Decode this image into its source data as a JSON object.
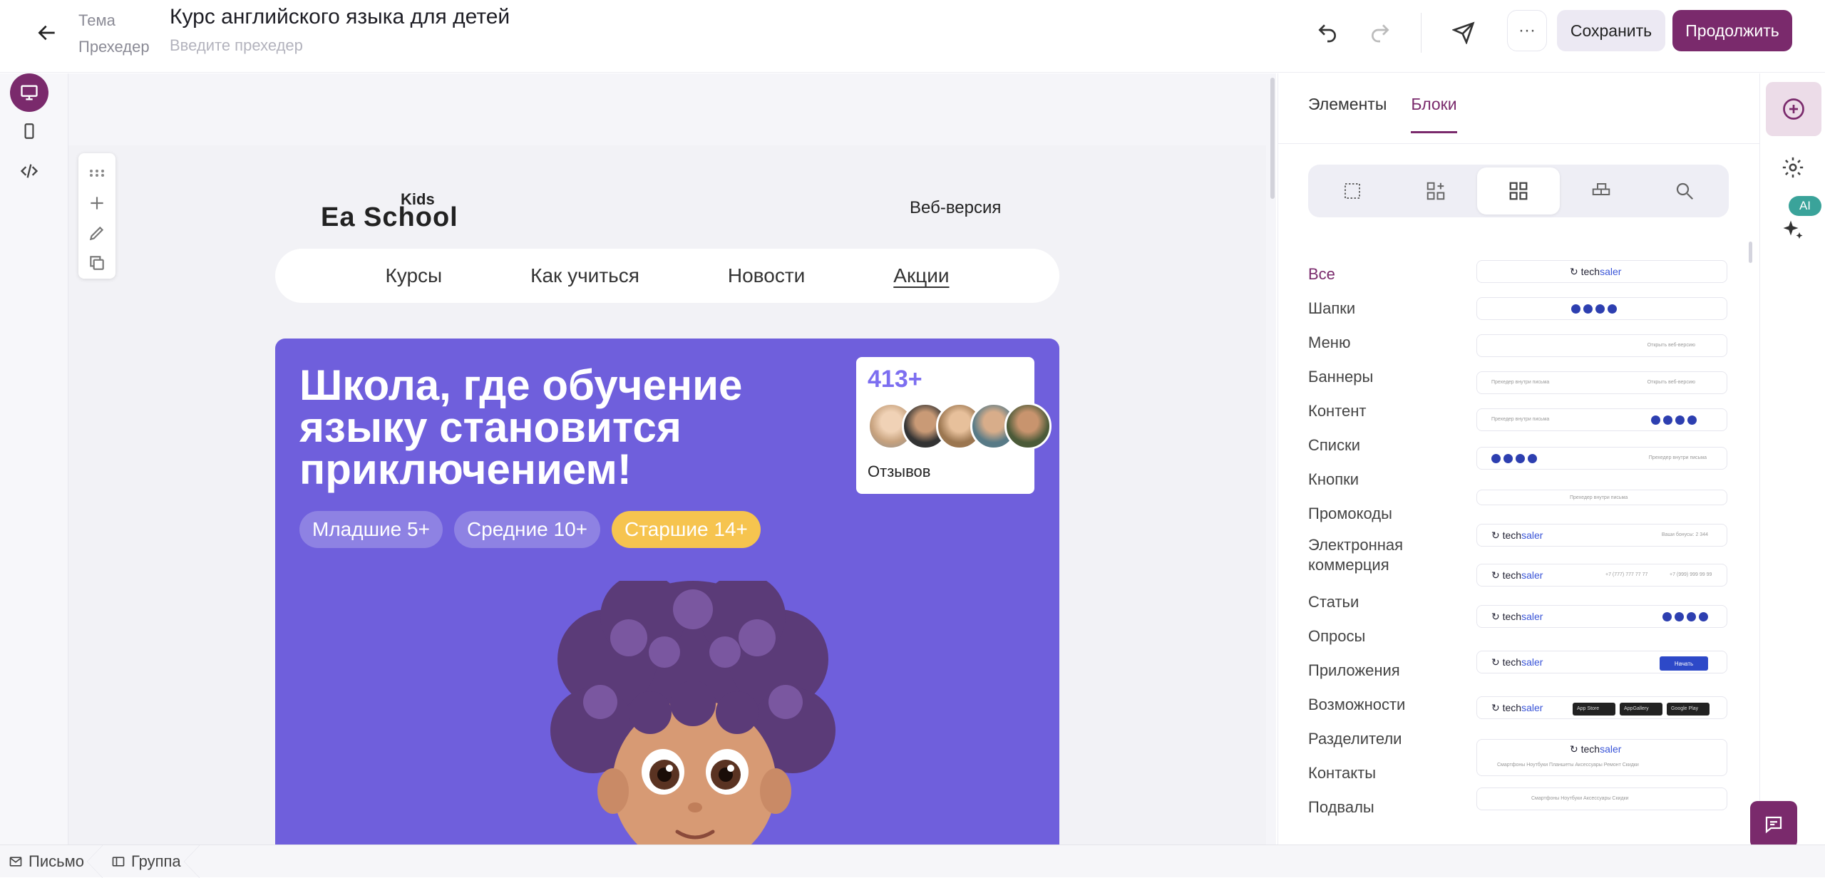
{
  "header": {
    "subject_label": "Тема",
    "preheader_label": "Прехедер",
    "subject_value": "Курс английского языка для детей",
    "preheader_placeholder": "Введите прехедер",
    "more_label": "···",
    "save_label": "Сохранить",
    "continue_label": "Продолжить"
  },
  "email": {
    "logo_small": "Kids",
    "logo_main": "Ea School",
    "web_version": "Веб-версия",
    "nav": [
      "Курсы",
      "Как учиться",
      "Новости",
      "Акции"
    ],
    "hero_title": "Школа, где обучение\nязыку становится\nприключением!",
    "tags": [
      "Младшие 5+",
      "Средние 10+",
      "Старшие 14+"
    ],
    "reviews_count": "413+",
    "reviews_label": "Отзывов"
  },
  "sidebar": {
    "tabs": [
      "Элементы",
      "Блоки"
    ],
    "categories": [
      "Все",
      "Шапки",
      "Меню",
      "Баннеры",
      "Контент",
      "Списки",
      "Кнопки",
      "Промокоды",
      "Электронная коммерция",
      "Статьи",
      "Опросы",
      "Приложения",
      "Возможности",
      "Разделители",
      "Контакты",
      "Подвалы"
    ],
    "thumbs": {
      "logo_a": "tech",
      "logo_b": "saler",
      "web_version": "Открыть веб-версию",
      "preheader": "Прехедер внутри письма",
      "balance": "Ваши бонусы: 2 344",
      "phone1": "+7 (777) 777 77 77",
      "phone2": "+7 (999) 999 99 99",
      "start_btn": "Начать",
      "app_store": "App Store",
      "app_gallery": "AppGallery",
      "google_play": "Google Play",
      "menu_items": "Смартфоны  Ноутбуки  Планшеты  Аксессуары  Ремонт  Скидки",
      "menu_items_short": "Смартфоны  Ноутбуки  Аксессуары  Скидки"
    }
  },
  "right_rail": {
    "ai_label": "AI"
  },
  "breadcrumb": [
    "Письмо",
    "Группа"
  ]
}
